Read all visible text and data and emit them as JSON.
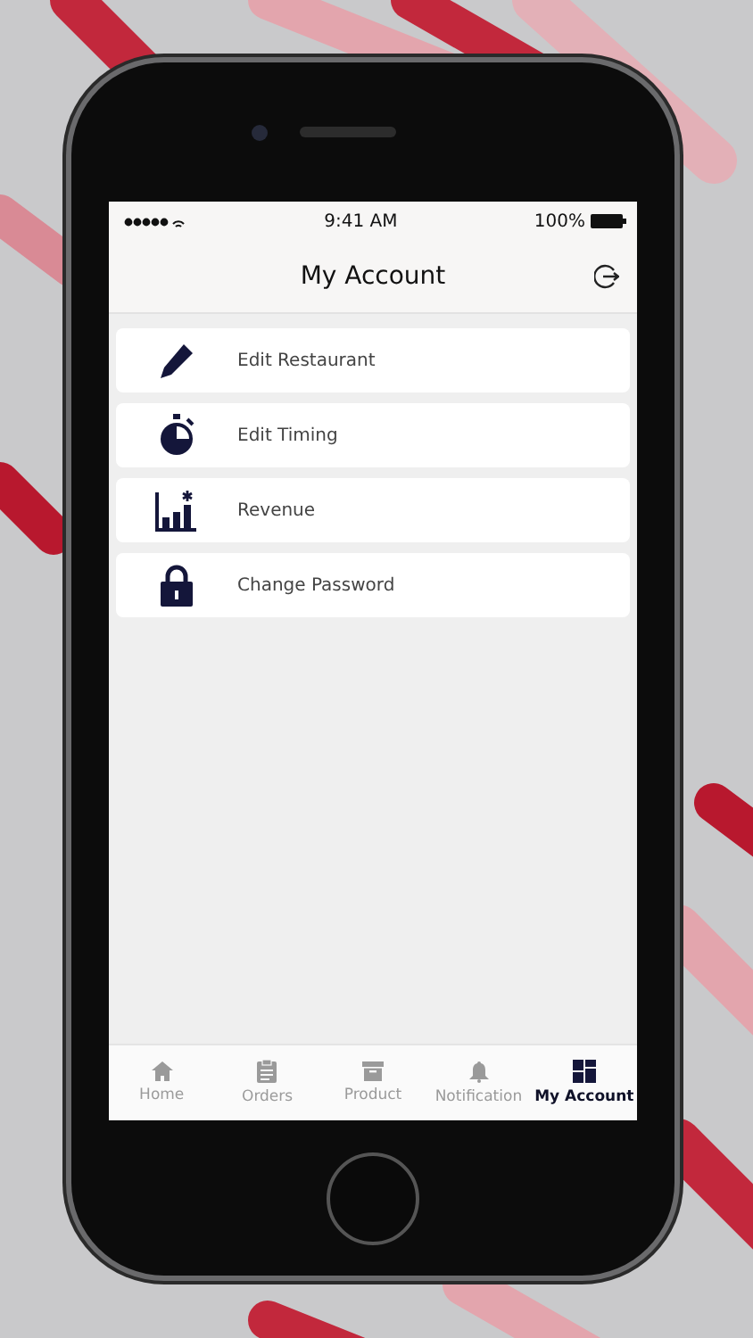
{
  "status_bar": {
    "time": "9:41 AM",
    "battery": "100%"
  },
  "header": {
    "title": "My Account"
  },
  "menu": [
    {
      "kind": "pencil",
      "label": "Edit Restaurant"
    },
    {
      "kind": "timer",
      "label": "Edit Timing"
    },
    {
      "kind": "chart",
      "label": "Revenue"
    },
    {
      "kind": "lock",
      "label": "Change Password"
    }
  ],
  "tabs": [
    {
      "kind": "home",
      "label": "Home",
      "selected": false
    },
    {
      "kind": "orders",
      "label": "Orders",
      "selected": false
    },
    {
      "kind": "product",
      "label": "Product",
      "selected": false
    },
    {
      "kind": "bell",
      "label": "Notification",
      "selected": false
    },
    {
      "kind": "account",
      "label": "My Account",
      "selected": true
    }
  ]
}
